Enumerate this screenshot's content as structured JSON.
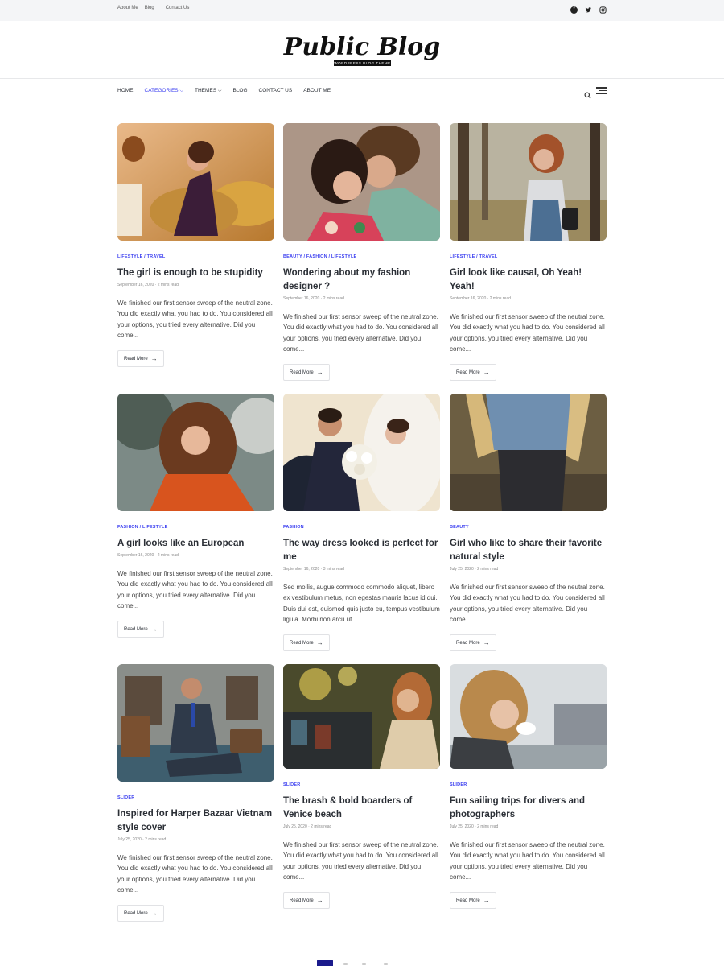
{
  "topbar": {
    "links": [
      "About Me",
      "Blog",
      "Contact Us"
    ],
    "social_icons": [
      "facebook-icon",
      "twitter-icon",
      "instagram-icon"
    ]
  },
  "logo": {
    "title": "Public Blog",
    "tagline": "WORDPRESS BLOG THEME"
  },
  "nav": {
    "items": [
      {
        "label": "HOME",
        "caret": ""
      },
      {
        "label": "CATEGORIES",
        "caret": "⌵"
      },
      {
        "label": "THEMES",
        "caret": "⌵"
      },
      {
        "label": "BLOG",
        "caret": ""
      },
      {
        "label": "CONTACT US",
        "caret": ""
      },
      {
        "label": "ABOUT ME",
        "caret": ""
      }
    ],
    "active": "CATEGORIES",
    "accent": "#3b3ff0"
  },
  "read_more_label": "Read More",
  "posts": [
    {
      "cats": "LIFESTYLE  / TRAVEL",
      "title": "The girl is enough to be stupidity",
      "meta": "September 16, 2020  ·  2 mins read",
      "excerpt": "We finished our first sensor sweep of the neutral zone. You did exactly what you had to do. You considered all your options, you tried every alternative. Did you come..."
    },
    {
      "cats": "BEAUTY  / FASHION  / LIFESTYLE",
      "title": "Wondering about my fashion designer ?",
      "meta": "September 16, 2020  ·  2 mins read",
      "excerpt": "We finished our first sensor sweep of the neutral zone. You did exactly what you had to do. You considered all your options, you tried every alternative. Did you come..."
    },
    {
      "cats": "LIFESTYLE  / TRAVEL",
      "title": "Girl look like causal, Oh Yeah! Yeah!",
      "meta": "September 16, 2020  ·  2 mins read",
      "excerpt": "We finished our first sensor sweep of the neutral zone. You did exactly what you had to do. You considered all your options, you tried every alternative. Did you come..."
    },
    {
      "cats": "FASHION  / LIFESTYLE",
      "title": "A girl looks like an European",
      "meta": "September 16, 2020  ·  2 mins read",
      "excerpt": "We finished our first sensor sweep of the neutral zone. You did exactly what you had to do. You considered all your options, you tried every alternative. Did you come..."
    },
    {
      "cats": "FASHION",
      "title": "The way dress looked is perfect for me",
      "meta": "September 16, 2020  ·  3 mins read",
      "excerpt": "Sed mollis, augue commodo commodo aliquet, libero ex vestibulum metus, non egestas mauris lacus id dui. Duis dui est, euismod quis justo eu, tempus vestibulum ligula. Morbi non arcu ut..."
    },
    {
      "cats": "BEAUTY",
      "title": "Girl who like to share their favorite natural style",
      "meta": "July 25, 2020  ·  2 mins read",
      "excerpt": "We finished our first sensor sweep of the neutral zone. You did exactly what you had to do. You considered all your options, you tried every alternative. Did you come..."
    },
    {
      "cats": "SLIDER",
      "title": "Inspired for Harper Bazaar Vietnam style cover",
      "meta": "July 25, 2020  ·  2 mins read",
      "excerpt": "We finished our first sensor sweep of the neutral zone. You did exactly what you had to do. You considered all your options, you tried every alternative. Did you come..."
    },
    {
      "cats": "SLIDER",
      "title": "The brash & bold boarders of Venice beach",
      "meta": "July 25, 2020  ·  2 mins read",
      "excerpt": "We finished our first sensor sweep of the neutral zone. You did exactly what you had to do. You considered all your options, you tried every alternative. Did you come..."
    },
    {
      "cats": "SLIDER",
      "title": "Fun sailing trips for divers and photographers",
      "meta": "July 25, 2020  ·  2 mins read",
      "excerpt": "We finished our first sensor sweep of the neutral zone. You did exactly what you had to do. You considered all your options, you tried every alternative. Did you come..."
    }
  ]
}
